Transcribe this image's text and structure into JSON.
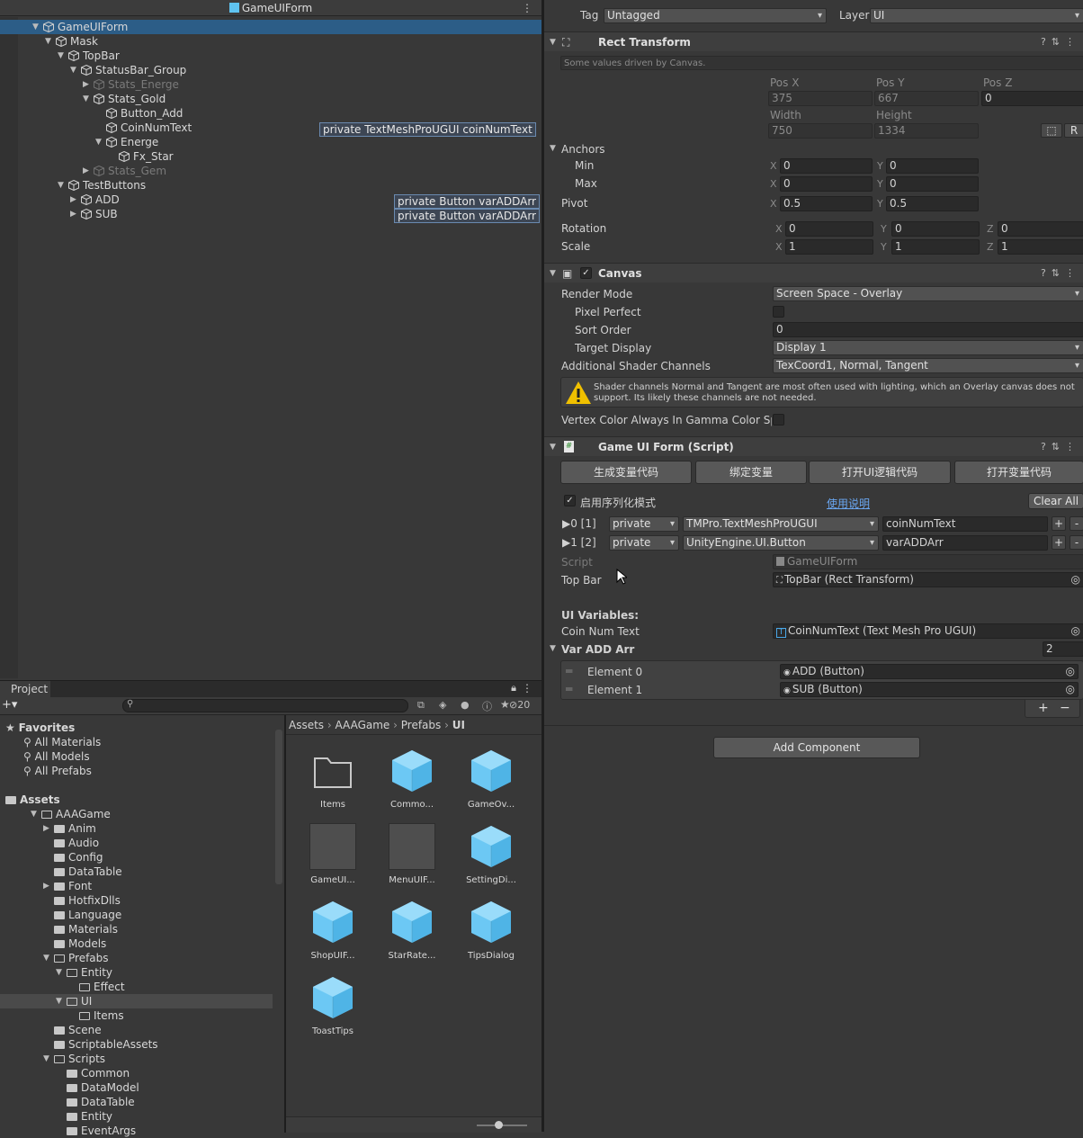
{
  "hierarchy": {
    "title": "GameUIForm",
    "rows": [
      {
        "label": "GameUIForm",
        "depth": 0,
        "selected": true,
        "expanded": true,
        "dim": false
      },
      {
        "label": "Mask",
        "depth": 1,
        "expanded": true,
        "dim": false
      },
      {
        "label": "TopBar",
        "depth": 2,
        "expanded": true,
        "dim": false
      },
      {
        "label": "StatusBar_Group",
        "depth": 3,
        "expanded": true,
        "dim": false
      },
      {
        "label": "Stats_Energe",
        "depth": 4,
        "expanded": false,
        "dim": true
      },
      {
        "label": "Stats_Gold",
        "depth": 4,
        "expanded": true,
        "dim": false
      },
      {
        "label": "Button_Add",
        "depth": 5,
        "leaf": true,
        "dim": false
      },
      {
        "label": "CoinNumText",
        "depth": 5,
        "leaf": true,
        "dim": false
      },
      {
        "label": "Energe",
        "depth": 5,
        "expanded": true,
        "dim": false
      },
      {
        "label": "Fx_Star",
        "depth": 6,
        "leaf": true,
        "dim": false
      },
      {
        "label": "Stats_Gem",
        "depth": 4,
        "expanded": false,
        "dim": true
      },
      {
        "label": "TestButtons",
        "depth": 2,
        "expanded": true,
        "dim": false
      },
      {
        "label": "ADD",
        "depth": 3,
        "expanded": false,
        "dim": false
      },
      {
        "label": "SUB",
        "depth": 3,
        "expanded": false,
        "dim": false
      }
    ],
    "tags": [
      "private TextMeshProUGUI coinNumText",
      "private Button varADDArr",
      "private Button varADDArr"
    ]
  },
  "inspector": {
    "tag_label": "Tag",
    "tag_value": "Untagged",
    "layer_label": "Layer",
    "layer_value": "UI",
    "rect_transform": {
      "title": "Rect Transform",
      "note": "Some values driven by Canvas.",
      "pos_x_label": "Pos X",
      "pos_y_label": "Pos Y",
      "pos_z_label": "Pos Z",
      "pos_x": "375",
      "pos_y": "667",
      "pos_z": "0",
      "width_label": "Width",
      "height_label": "Height",
      "width": "750",
      "height": "1334",
      "r_label": "R",
      "anchors_label": "Anchors",
      "min_label": "Min",
      "max_label": "Max",
      "min_x": "0",
      "min_y": "0",
      "max_x": "0",
      "max_y": "0",
      "pivot_label": "Pivot",
      "pivot_x": "0.5",
      "pivot_y": "0.5",
      "rotation_label": "Rotation",
      "rot_x": "0",
      "rot_y": "0",
      "rot_z": "0",
      "scale_label": "Scale",
      "scale_x": "1",
      "scale_y": "1",
      "scale_z": "1",
      "x": "X",
      "y": "Y",
      "z": "Z"
    },
    "canvas": {
      "title": "Canvas",
      "render_mode_label": "Render Mode",
      "render_mode": "Screen Space - Overlay",
      "pixel_perfect_label": "Pixel Perfect",
      "sort_order_label": "Sort Order",
      "sort_order": "0",
      "target_display_label": "Target Display",
      "target_display": "Display 1",
      "shader_channels_label": "Additional Shader Channels",
      "shader_channels": "TexCoord1, Normal, Tangent",
      "warning": "Shader channels Normal and Tangent are most often used with lighting, which an Overlay canvas does not support. Its likely these channels are not needed.",
      "vertex_color_label": "Vertex Color Always In Gamma Color Spac"
    },
    "script": {
      "title": "Game UI Form (Script)",
      "buttons": [
        "生成变量代码",
        "绑定变量",
        "打开UI逻辑代码",
        "打开变量代码"
      ],
      "serialize_label": "启用序列化模式",
      "help_link": "使用说明",
      "clear_all": "Clear All",
      "vars": [
        {
          "index": "0 [1]",
          "access": "private",
          "type": "TMPro.TextMeshProUGUI",
          "name": "coinNumText"
        },
        {
          "index": "1 [2]",
          "access": "private",
          "type": "UnityEngine.UI.Button",
          "name": "varADDArr"
        }
      ],
      "plus": "+",
      "minus": "-",
      "script_label": "Script",
      "script_value": "GameUIForm",
      "topbar_label": "Top Bar",
      "topbar_value": "TopBar (Rect Transform)",
      "ui_vars_label": "UI Variables:",
      "coin_label": "Coin Num Text",
      "coin_value": "CoinNumText (Text Mesh Pro UGUI)",
      "arr_label": "Var ADD Arr",
      "arr_size": "2",
      "elements": [
        {
          "label": "Element 0",
          "value": "ADD (Button)"
        },
        {
          "label": "Element 1",
          "value": "SUB (Button)"
        }
      ],
      "list_plus": "+",
      "list_minus": "−"
    },
    "add_component": "Add Component"
  },
  "project": {
    "tab": "Project",
    "hidden_count": "20",
    "tree": [
      {
        "label": "Favorites",
        "depth": 0,
        "kind": "star",
        "bold": true
      },
      {
        "label": "All Materials",
        "depth": 1,
        "kind": "search"
      },
      {
        "label": "All Models",
        "depth": 1,
        "kind": "search"
      },
      {
        "label": "All Prefabs",
        "depth": 1,
        "kind": "search"
      },
      {
        "label": "",
        "depth": 0,
        "kind": "gap"
      },
      {
        "label": "Assets",
        "depth": 0,
        "kind": "folder",
        "bold": true
      },
      {
        "label": "AAAGame",
        "depth": 1,
        "kind": "folder-open",
        "arrow": "▼"
      },
      {
        "label": "Anim",
        "depth": 2,
        "kind": "folder",
        "arrow": "▶"
      },
      {
        "label": "Audio",
        "depth": 2,
        "kind": "folder"
      },
      {
        "label": "Config",
        "depth": 2,
        "kind": "folder"
      },
      {
        "label": "DataTable",
        "depth": 2,
        "kind": "folder"
      },
      {
        "label": "Font",
        "depth": 2,
        "kind": "folder",
        "arrow": "▶"
      },
      {
        "label": "HotfixDlls",
        "depth": 2,
        "kind": "folder"
      },
      {
        "label": "Language",
        "depth": 2,
        "kind": "folder"
      },
      {
        "label": "Materials",
        "depth": 2,
        "kind": "folder"
      },
      {
        "label": "Models",
        "depth": 2,
        "kind": "folder"
      },
      {
        "label": "Prefabs",
        "depth": 2,
        "kind": "folder-open",
        "arrow": "▼"
      },
      {
        "label": "Entity",
        "depth": 3,
        "kind": "folder-open",
        "arrow": "▼"
      },
      {
        "label": "Effect",
        "depth": 4,
        "kind": "folder-open"
      },
      {
        "label": "UI",
        "depth": 3,
        "kind": "folder-open",
        "arrow": "▼",
        "selected": true
      },
      {
        "label": "Items",
        "depth": 4,
        "kind": "folder-open"
      },
      {
        "label": "Scene",
        "depth": 2,
        "kind": "folder"
      },
      {
        "label": "ScriptableAssets",
        "depth": 2,
        "kind": "folder"
      },
      {
        "label": "Scripts",
        "depth": 2,
        "kind": "folder-open",
        "arrow": "▼"
      },
      {
        "label": "Common",
        "depth": 3,
        "kind": "folder"
      },
      {
        "label": "DataModel",
        "depth": 3,
        "kind": "folder"
      },
      {
        "label": "DataTable",
        "depth": 3,
        "kind": "folder"
      },
      {
        "label": "Entity",
        "depth": 3,
        "kind": "folder"
      },
      {
        "label": "EventArgs",
        "depth": 3,
        "kind": "folder"
      }
    ],
    "breadcrumb": [
      "Assets",
      "AAAGame",
      "Prefabs",
      "UI"
    ],
    "assets": [
      {
        "label": "Items",
        "kind": "folder"
      },
      {
        "label": "Commo...",
        "kind": "prefab"
      },
      {
        "label": "GameOv...",
        "kind": "prefab"
      },
      {
        "label": "GameUI...",
        "kind": "gray"
      },
      {
        "label": "MenuUIF...",
        "kind": "gray"
      },
      {
        "label": "SettingDi...",
        "kind": "prefab"
      },
      {
        "label": "ShopUIF...",
        "kind": "prefab"
      },
      {
        "label": "StarRate...",
        "kind": "prefab"
      },
      {
        "label": "TipsDialog",
        "kind": "prefab"
      },
      {
        "label": "ToastTips",
        "kind": "prefab"
      }
    ]
  }
}
